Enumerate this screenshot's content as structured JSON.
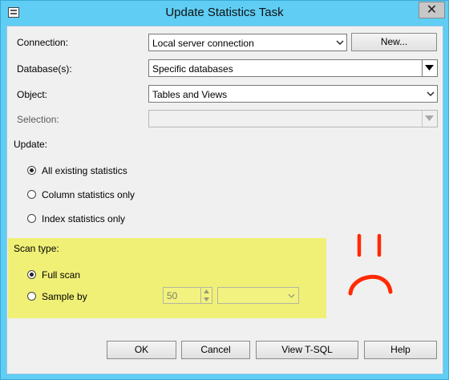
{
  "window": {
    "title": "Update Statistics Task",
    "close_glyph": "✕"
  },
  "form": {
    "connection": {
      "label": "Connection:",
      "value": "Local server connection",
      "new_button": "New..."
    },
    "databases": {
      "label": "Database(s):",
      "value": "Specific databases"
    },
    "object": {
      "label": "Object:",
      "value": "Tables and Views"
    },
    "selection": {
      "label": "Selection:",
      "value": ""
    }
  },
  "update": {
    "label": "Update:",
    "options": [
      {
        "label": "All existing statistics",
        "checked": true
      },
      {
        "label": "Column statistics only",
        "checked": false
      },
      {
        "label": "Index statistics only",
        "checked": false
      }
    ]
  },
  "scan": {
    "label": "Scan type:",
    "options": [
      {
        "label": "Full scan",
        "checked": true
      },
      {
        "label": "Sample by",
        "checked": false
      }
    ],
    "sample_value": "50",
    "sample_unit": ""
  },
  "buttons": {
    "ok": "OK",
    "cancel": "Cancel",
    "view_tsql": "View T-SQL",
    "help": "Help"
  },
  "colors": {
    "highlight": "#f0f077",
    "annotation": "#ff2a00",
    "title_bar": "#5fcdf4"
  },
  "annotation": {
    "icon": "sad-face-icon"
  }
}
